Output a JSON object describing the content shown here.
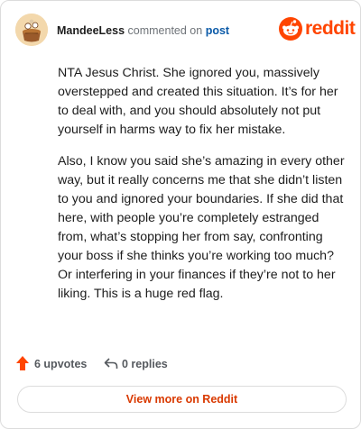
{
  "header": {
    "username": "MandeeLess",
    "action_text": "commented on",
    "post_link": "post"
  },
  "brand": {
    "wordmark": "reddit",
    "color": "#ff4500"
  },
  "comment": {
    "paragraphs": [
      "NTA Jesus Christ. She ignored you, massively overstepped and created this situation. It’s for her to deal with, and you should absolutely not put yourself in harms way to fix her mistake.",
      "Also, I know you said she’s amazing in every other way, but it really concerns me that she didn’t listen to you and ignored your boundaries. If she did that here, with people you’re completely estranged from, what’s stopping her from say, confronting your boss if she thinks you’re working too much? Or interfering in your finances if they’re not to her liking. This is a huge red flag."
    ]
  },
  "footer": {
    "upvotes": "6 upvotes",
    "replies": "0 replies",
    "upvote_icon": "upvote-arrow-icon",
    "reply_icon": "reply-arrow-icon"
  },
  "cta": {
    "label": "View more on Reddit"
  }
}
